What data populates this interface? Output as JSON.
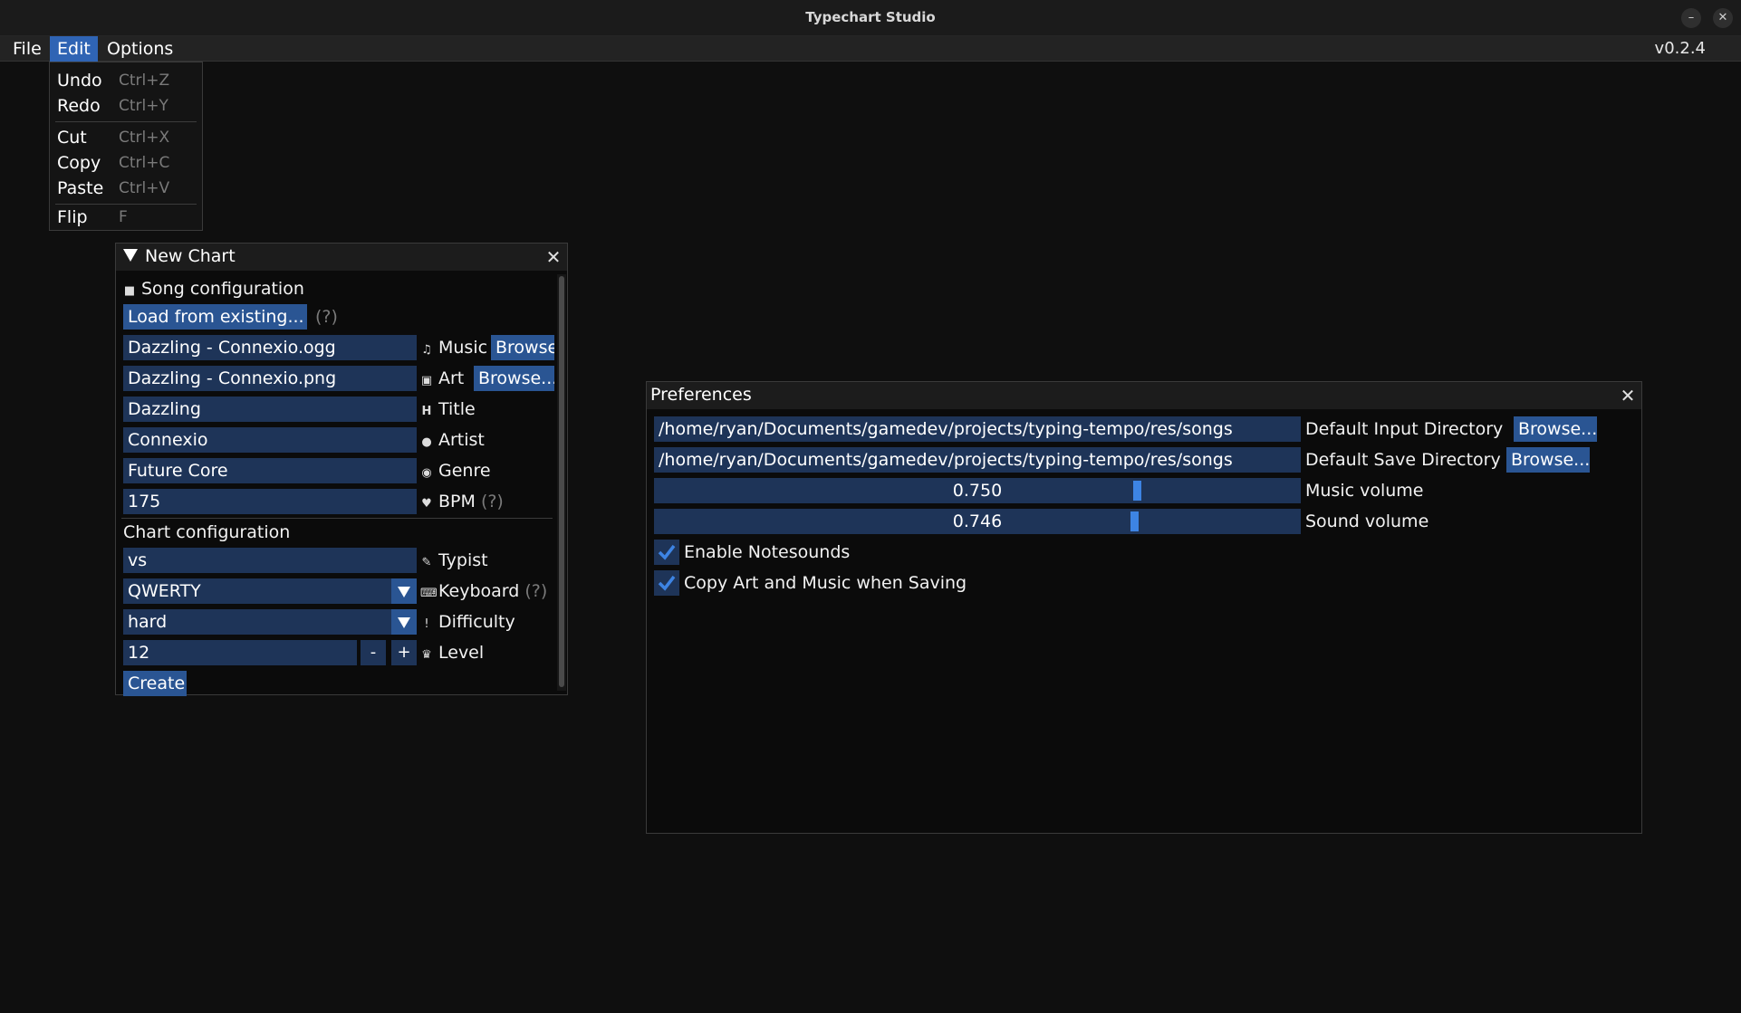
{
  "window": {
    "title": "Typechart Studio"
  },
  "menubar": {
    "items": [
      "File",
      "Edit",
      "Options"
    ],
    "active": "Edit",
    "version": "v0.2.4"
  },
  "edit_menu": [
    {
      "label": "Undo",
      "shortcut": "Ctrl+Z"
    },
    {
      "label": "Redo",
      "shortcut": "Ctrl+Y"
    },
    {
      "label": "Cut",
      "shortcut": "Ctrl+X"
    },
    {
      "label": "Copy",
      "shortcut": "Ctrl+C"
    },
    {
      "label": "Paste",
      "shortcut": "Ctrl+V"
    },
    {
      "label": "Flip",
      "shortcut": "F"
    }
  ],
  "new_chart": {
    "title": "New Chart",
    "song_section": "Song configuration",
    "load_button": "Load from existing...",
    "help": "(?)",
    "music_file": "Dazzling - Connexio.ogg",
    "music_label": "Music",
    "music_browse": "Browse...",
    "art_file": "Dazzling - Connexio.png",
    "art_label": "Art",
    "art_browse": "Browse...",
    "title_value": "Dazzling",
    "title_label": "Title",
    "artist_value": "Connexio",
    "artist_label": "Artist",
    "genre_value": "Future Core",
    "genre_label": "Genre",
    "bpm_value": "175",
    "bpm_label": "BPM",
    "chart_section": "Chart configuration",
    "typist_value": "vs",
    "typist_label": "Typist",
    "keyboard_value": "QWERTY",
    "keyboard_label": "Keyboard",
    "difficulty_value": "hard",
    "difficulty_label": "Difficulty",
    "level_value": "12",
    "level_minus": "-",
    "level_plus": "+",
    "level_label": "Level",
    "create_button": "Create"
  },
  "preferences": {
    "title": "Preferences",
    "input_dir": "/home/ryan/Documents/gamedev/projects/typing-tempo/res/songs",
    "input_dir_label": "Default Input Directory",
    "save_dir": "/home/ryan/Documents/gamedev/projects/typing-tempo/res/songs",
    "save_dir_label": "Default Save Directory",
    "browse": "Browse...",
    "music_volume": "0.750",
    "music_volume_fraction": 0.75,
    "music_volume_label": "Music volume",
    "sound_volume": "0.746",
    "sound_volume_fraction": 0.746,
    "sound_volume_label": "Sound volume",
    "enable_notesounds": "Enable Notesounds",
    "enable_notesounds_checked": true,
    "copy_art_music": "Copy Art and Music when Saving",
    "copy_art_music_checked": true
  },
  "colors": {
    "accent": "#2a5593",
    "field": "#1e3458",
    "menu_active": "#2f64b4",
    "slider_grab": "#3d84e4"
  }
}
